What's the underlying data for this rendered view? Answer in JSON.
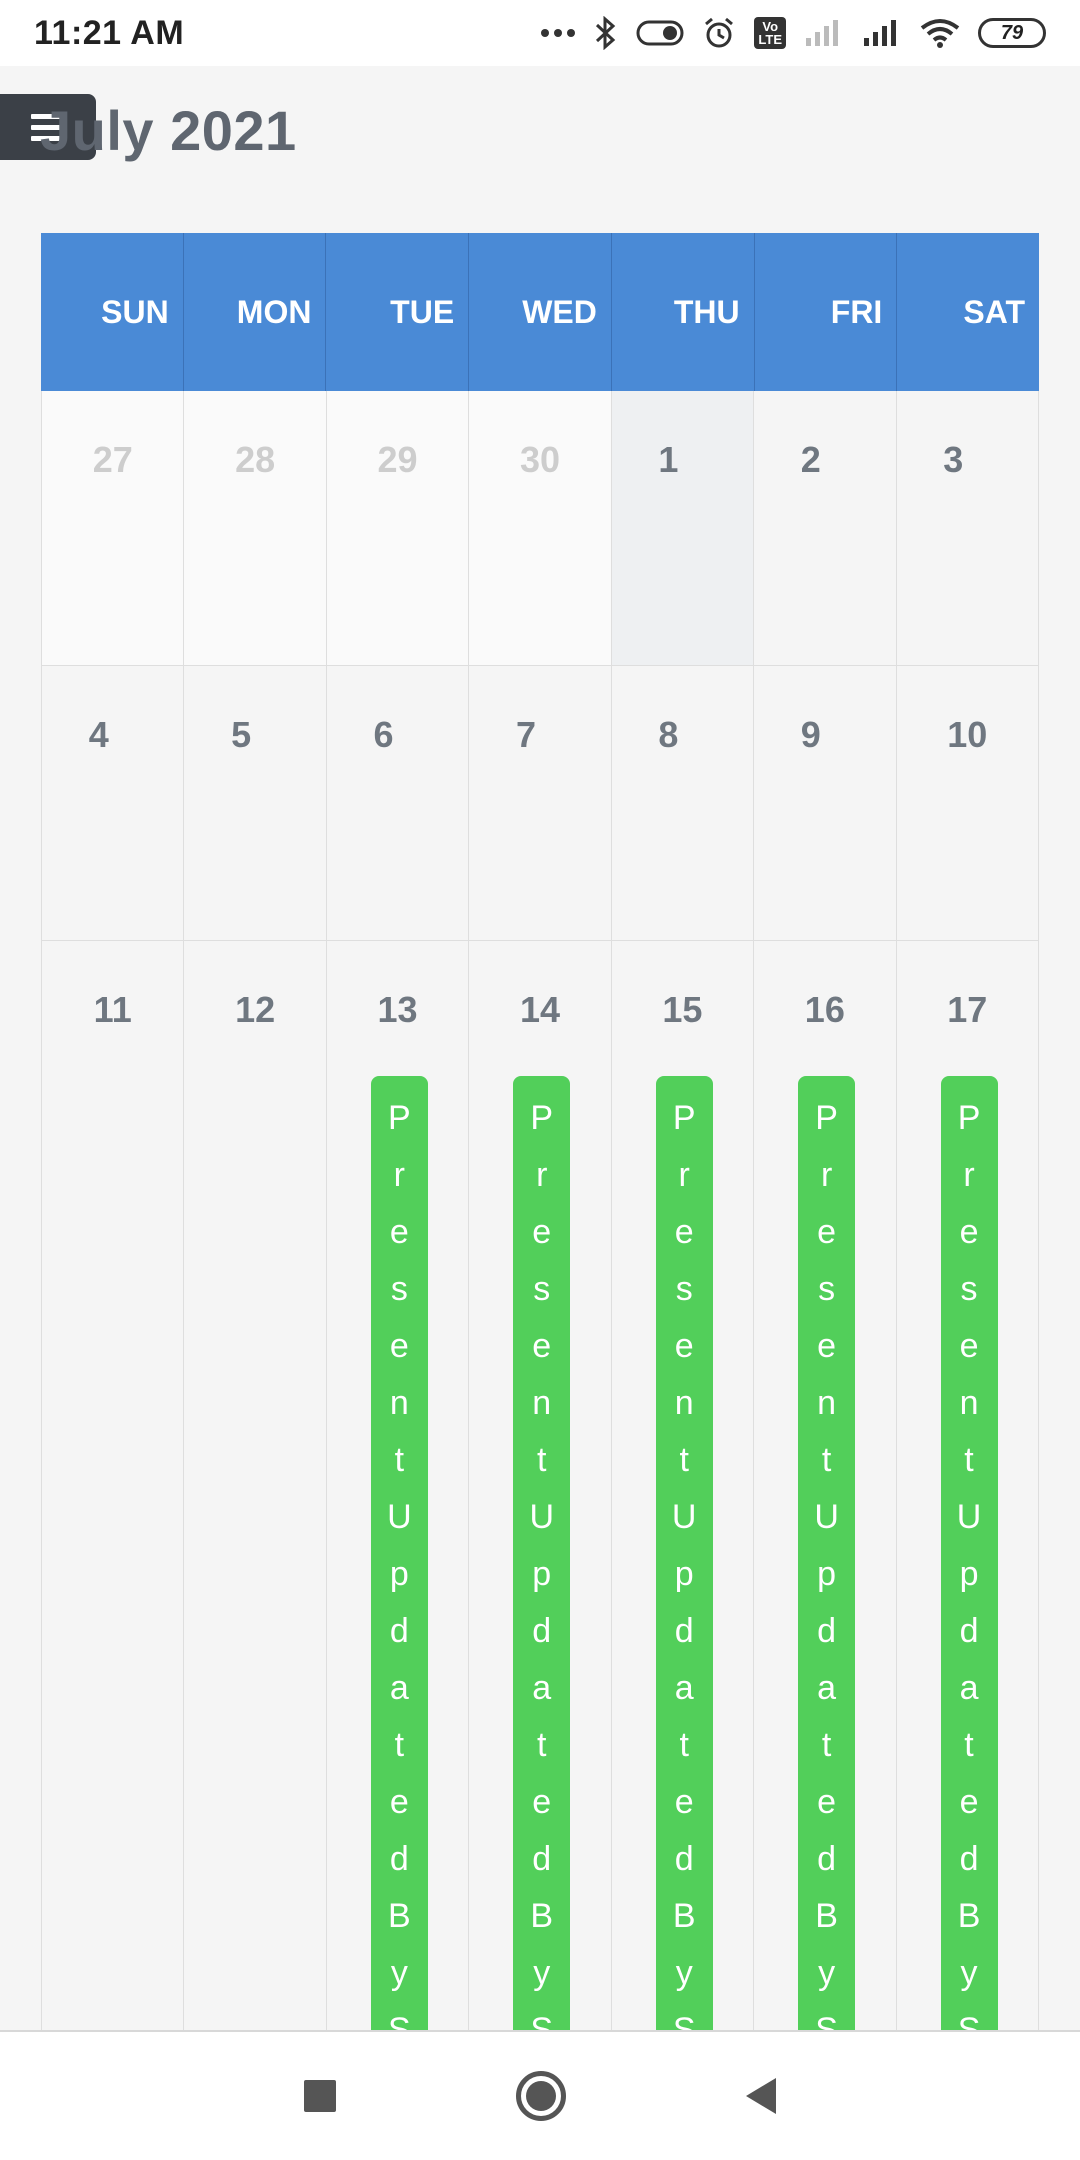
{
  "status_bar": {
    "time": "11:21 AM",
    "volte": "Vo\nLTE",
    "battery": "79"
  },
  "header": {
    "title": "July 2021",
    "menu_icon": "hamburger-menu-icon"
  },
  "weekdays": [
    "SUN",
    "MON",
    "TUE",
    "WED",
    "THU",
    "FRI",
    "SAT"
  ],
  "weeks": [
    [
      {
        "day": "27",
        "other": true
      },
      {
        "day": "28",
        "other": true
      },
      {
        "day": "29",
        "other": true
      },
      {
        "day": "30",
        "other": true
      },
      {
        "day": "1",
        "today": true
      },
      {
        "day": "2"
      },
      {
        "day": "3"
      }
    ],
    [
      {
        "day": "4"
      },
      {
        "day": "5"
      },
      {
        "day": "6"
      },
      {
        "day": "7"
      },
      {
        "day": "8"
      },
      {
        "day": "9"
      },
      {
        "day": "10"
      }
    ],
    [
      {
        "day": "11"
      },
      {
        "day": "12"
      },
      {
        "day": "13",
        "event": "PresentUpdatedByS"
      },
      {
        "day": "14",
        "event": "PresentUpdatedByS"
      },
      {
        "day": "15",
        "event": "PresentUpdatedByS"
      },
      {
        "day": "16",
        "event": "PresentUpdatedByS"
      },
      {
        "day": "17",
        "event": "PresentUpdatedByS"
      }
    ]
  ],
  "colors": {
    "header_blue": "#4a8ad6",
    "event_green": "#52cf5a",
    "title_gray": "#5f6670"
  },
  "nav_bar": {
    "icons": [
      "recent-apps-icon",
      "home-icon",
      "back-icon"
    ]
  }
}
